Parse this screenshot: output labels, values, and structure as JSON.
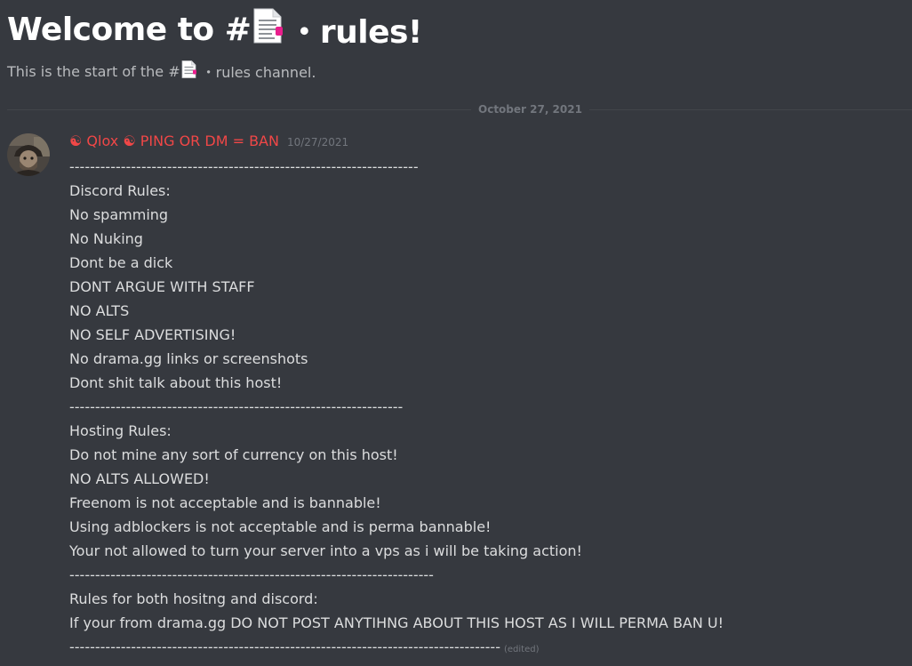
{
  "channel": {
    "welcome_prefix": "Welcome to #",
    "name_suffix": "・rules!",
    "start_prefix": "This is the start of the #",
    "start_suffix": "・rules channel.",
    "icon": "page-facing-up-icon"
  },
  "divider": {
    "date": "October 27, 2021"
  },
  "message": {
    "author": "☯ Qlox ☯ PING OR DM = BAN",
    "author_color": "#f04747",
    "timestamp": "10/27/2021",
    "avatar": "user-avatar",
    "lines": [
      "--------------------------------------------------------------------",
      "Discord Rules:",
      "No spamming",
      "No Nuking",
      "Dont be a dick",
      "DONT ARGUE WITH STAFF",
      "NO ALTS",
      "NO SELF ADVERTISING!",
      "No drama.gg links or screenshots",
      "Dont shit talk about this host!",
      "-----------------------------------------------------------------",
      "Hosting Rules:",
      "Do not mine any sort of currency on this host!",
      "NO ALTS ALLOWED!",
      "Freenom is not acceptable and is bannable!",
      "Using adblockers is not acceptable and is perma bannable!",
      "Your not allowed to turn your server into a vps as i will be taking action!",
      "-----------------------------------------------------------------------",
      "Rules for both hositng and discord:",
      "If your from drama.gg DO NOT POST ANYTIHNG ABOUT THIS HOST AS I WILL PERMA BAN U!",
      "------------------------------------------------------------------------------------"
    ],
    "edited_label": "(edited)"
  },
  "colors": {
    "background": "#36393f",
    "text": "#dcddde",
    "muted": "#72767d",
    "heading": "#ffffff",
    "icon_accent": "#e91e8c"
  }
}
